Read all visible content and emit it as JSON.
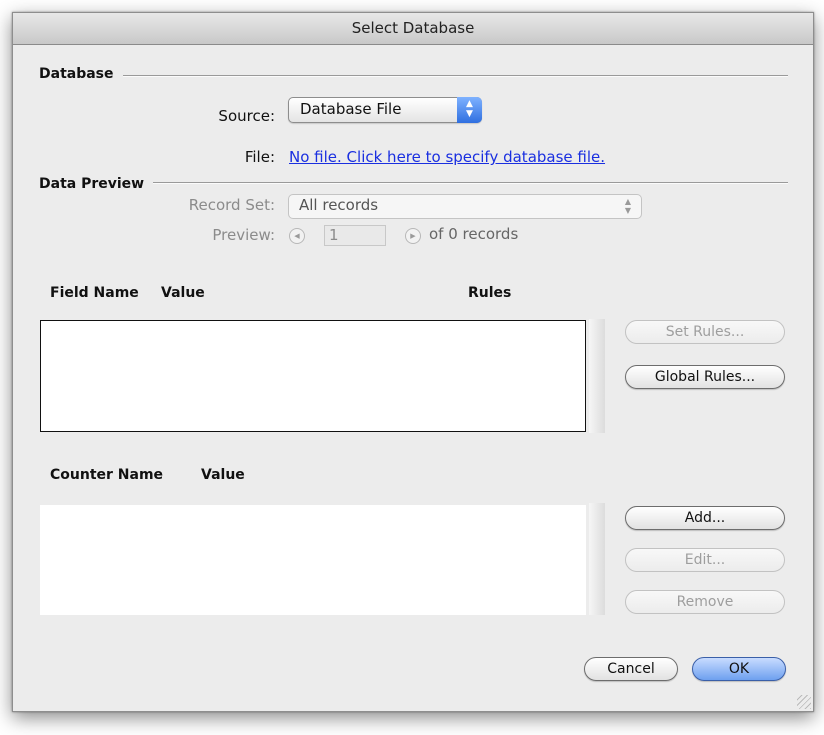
{
  "window": {
    "title": "Select Database"
  },
  "database": {
    "section_label": "Database",
    "source_label": "Source:",
    "source_value": "Database File",
    "file_label": "File:",
    "file_link": "No file. Click here to specify database file."
  },
  "preview": {
    "section_label": "Data Preview",
    "record_set_label": "Record Set:",
    "record_set_value": "All records",
    "preview_label": "Preview:",
    "preview_value": "1",
    "count_text": "of 0 records"
  },
  "fields": {
    "columns": [
      "Field Name",
      "Value",
      "Rules"
    ],
    "rows": []
  },
  "counters": {
    "columns": [
      "Counter Name",
      "Value"
    ],
    "rows": []
  },
  "buttons": {
    "set_rules": "Set Rules...",
    "global_rules": "Global Rules...",
    "add": "Add...",
    "edit": "Edit...",
    "remove": "Remove",
    "cancel": "Cancel",
    "ok": "OK"
  },
  "colors": {
    "link": "#1a2fe0",
    "default_button": "#6ea0ef",
    "disabled_text": "#9e9e9e"
  }
}
